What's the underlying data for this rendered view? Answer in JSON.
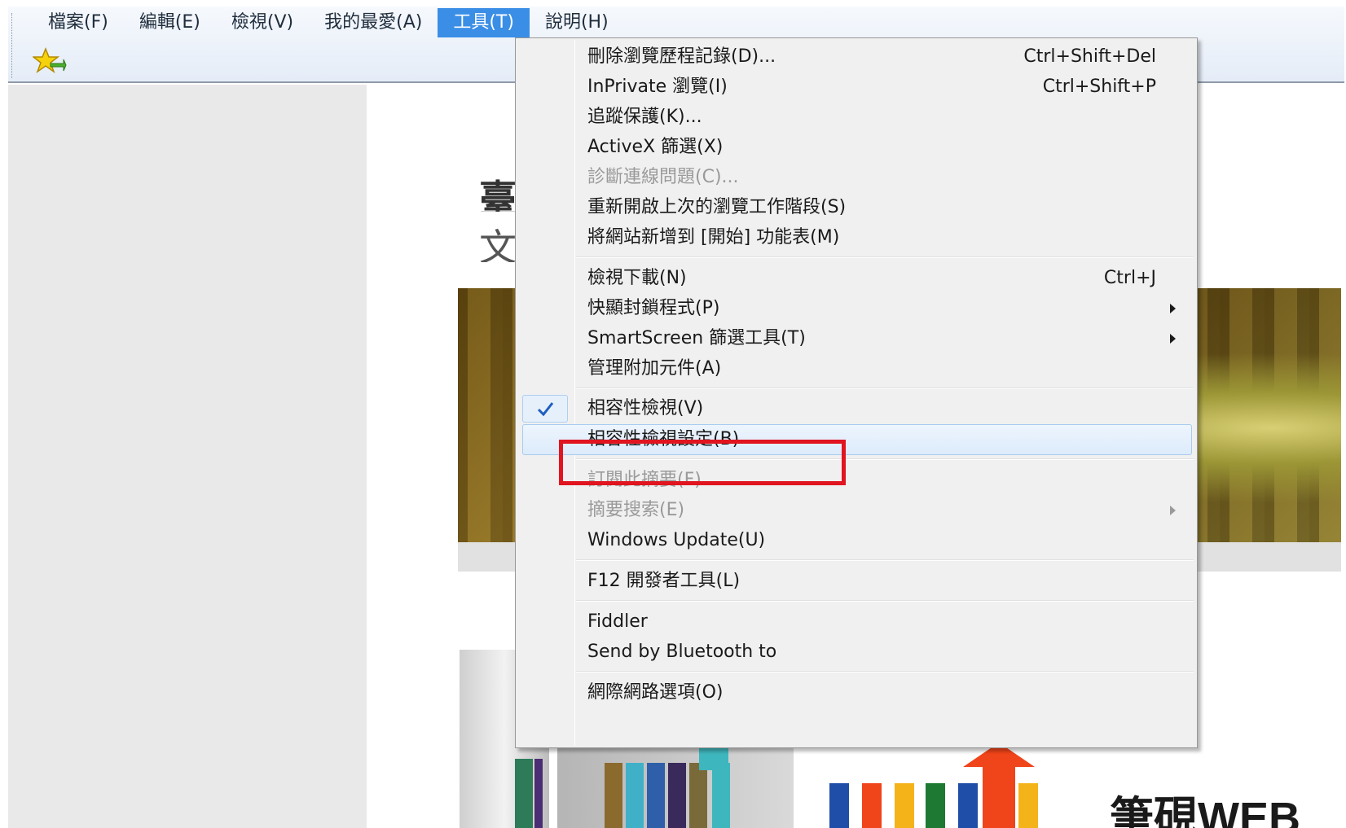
{
  "menubar": {
    "items": [
      {
        "label": "檔案(F)"
      },
      {
        "label": "編輯(E)"
      },
      {
        "label": "檢視(V)"
      },
      {
        "label": "我的最愛(A)"
      },
      {
        "label": "工具(T)",
        "active": true
      },
      {
        "label": "說明(H)"
      }
    ]
  },
  "toolbar": {
    "favorites_icon": "add-favorites-star-icon"
  },
  "page": {
    "title_partial": "臺",
    "subtitle_partial": "文",
    "brand_text": "筆硯WEB"
  },
  "tools_menu": {
    "items": [
      {
        "label": "刪除瀏覽歷程記錄(D)...",
        "shortcut": "Ctrl+Shift+Del"
      },
      {
        "label": "InPrivate 瀏覽(I)",
        "shortcut": "Ctrl+Shift+P"
      },
      {
        "label": "追蹤保護(K)..."
      },
      {
        "label": "ActiveX 篩選(X)"
      },
      {
        "label": "診斷連線問題(C)...",
        "disabled": true
      },
      {
        "label": "重新開啟上次的瀏覽工作階段(S)"
      },
      {
        "label": "將網站新增到 [開始] 功能表(M)"
      },
      {
        "label": "檢視下載(N)",
        "shortcut": "Ctrl+J"
      },
      {
        "label": "快顯封鎖程式(P)",
        "submenu": true
      },
      {
        "label": "SmartScreen 篩選工具(T)",
        "submenu": true
      },
      {
        "label": "管理附加元件(A)"
      },
      {
        "label": "相容性檢視(V)",
        "checked": true
      },
      {
        "label": "相容性檢視設定(B)",
        "hovered": true,
        "highlighted": true
      },
      {
        "label": "訂閱此摘要(F)...",
        "disabled": true
      },
      {
        "label": "摘要搜索(E)",
        "disabled": true,
        "submenu": true
      },
      {
        "label": "Windows Update(U)"
      },
      {
        "label": "F12 開發者工具(L)"
      },
      {
        "label": "Fiddler"
      },
      {
        "label": "Send by Bluetooth to"
      },
      {
        "label": "網際網路選項(O)"
      }
    ]
  },
  "colors": {
    "menu_active_bg": "#3a8ee6",
    "highlight_border": "#e0151f",
    "menu_bg": "#f0f0f0",
    "check_color": "#1e5fbf"
  }
}
